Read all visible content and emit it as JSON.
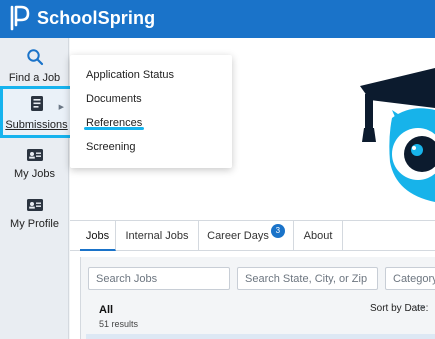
{
  "app": {
    "brand": "SchoolSpring"
  },
  "colors": {
    "brand_blue": "#1a73c9",
    "highlight": "#16b3ee",
    "sidebar_bg": "#e9edf2",
    "page_bg": "#f3f5f7"
  },
  "sidebar": {
    "items": [
      {
        "label": "Find a Job",
        "icon": "search-icon"
      },
      {
        "label": "Submissions",
        "icon": "document-icon",
        "has_submenu": true
      },
      {
        "label": "My Jobs",
        "icon": "id-card-icon"
      },
      {
        "label": "My Profile",
        "icon": "id-card-icon"
      }
    ]
  },
  "submissions_menu": {
    "items": [
      "Application Status",
      "Documents",
      "References",
      "Screening"
    ]
  },
  "tabs": [
    {
      "label": "Jobs",
      "active": true
    },
    {
      "label": "Internal Jobs"
    },
    {
      "label": "Career Days",
      "badge": "3"
    },
    {
      "label": "About"
    }
  ],
  "filters": {
    "search_placeholder": "Search Jobs",
    "location_placeholder": "Search State, City, or Zip",
    "category_placeholder": "Category"
  },
  "results": {
    "title": "All",
    "count": "51 results",
    "sort_label": "Sort by Date:"
  }
}
